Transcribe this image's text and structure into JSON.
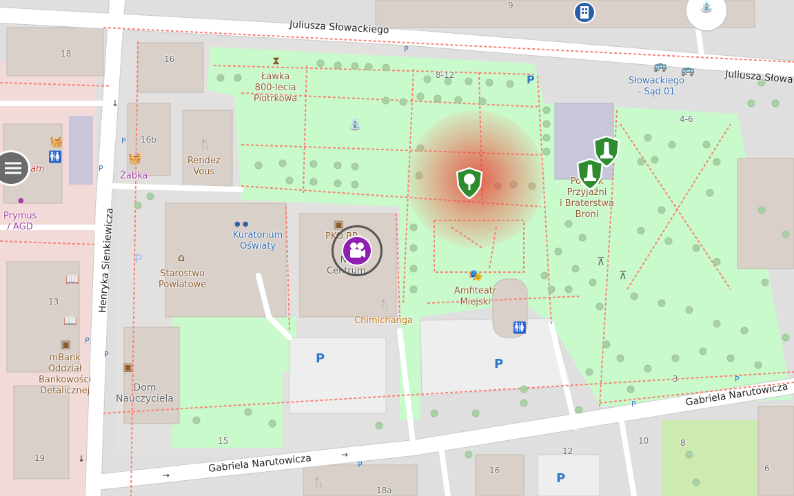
{
  "roads": {
    "slowackiego_top": "Juliusza Słowackiego",
    "slowackiego_right": "Juliusza Słowa",
    "sienkiewicza": "Henryka Sienkiewicza",
    "narutowicza_bottom": "Gabriela Narutowicza",
    "narutowicza_right": "Gabriela Narutowicza"
  },
  "places": {
    "lawka": [
      "Ławka",
      "800-lecia",
      "Piotrkowa"
    ],
    "rendez_vous": [
      "Rendez",
      "Vous"
    ],
    "zabka": "Żabka",
    "kuratorium": [
      "Kuratorium",
      "Oświaty"
    ],
    "pko": "PKO BP",
    "centrum": [
      "Na",
      "Centrum"
    ],
    "starostwo": [
      "Starostwo",
      "Powiatowe"
    ],
    "chimichanga": "Chimichanga",
    "amfiteatr": [
      "Amfiteatr",
      "Miejski"
    ],
    "pomnik": [
      "Pomnik",
      "Przyjaźni",
      "i Braterstwa",
      "Broni"
    ],
    "bus_stop": [
      "Słowackiego",
      "- Sąd 01"
    ],
    "mbank": [
      "mBank",
      "Oddział",
      "Bankowości",
      "Detalicznej"
    ],
    "dom": [
      "Dom",
      "Nauczyciela"
    ],
    "prymus": [
      "Prymus",
      "/ AGD"
    ],
    "partial_am": "am"
  },
  "house_numbers": [
    "18",
    "16",
    "16b",
    "13",
    "19",
    "15",
    "8-12",
    "4-6",
    "3",
    "10",
    "8",
    "12",
    "16",
    "18a",
    "6",
    "9"
  ],
  "parking_label": "P",
  "icons": {
    "camera": "camera-icon",
    "monument": "monument-icon",
    "tree_shield": "tree-icon",
    "fountain": "fountain-icon",
    "picnic": "picnic-table-icon"
  },
  "colors": {
    "park": "#c8facc",
    "road": "#ffffff",
    "building": "#d9d0c9",
    "residential": "#e0dfdf",
    "footway": "#fa8072",
    "heat": "#eb281e",
    "camera": "#8f1fb2",
    "shield": "#2e8b2e"
  }
}
